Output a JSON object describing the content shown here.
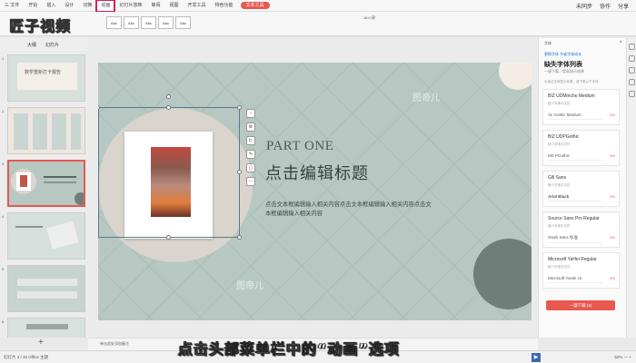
{
  "logo": {
    "text": "匠子视频"
  },
  "ribbon": {
    "tabs": [
      "三 文件",
      "开始",
      "插入",
      "设计",
      "切换",
      "动画",
      "幻灯片放映",
      "审阅",
      "视图",
      "开发工具",
      "特色功能"
    ],
    "highlighted_tab": "动画",
    "pill": "文本工具",
    "right": [
      "未同步",
      "协作",
      "分享"
    ]
  },
  "toolbar": {
    "style_boxes": [
      "Abc",
      "Abc",
      "Abc",
      "Abc",
      "Abc"
    ],
    "font_size_label": "16.0 磅"
  },
  "left_panel": {
    "tabs": [
      "大纲",
      "幻灯片"
    ],
    "slide_numbers": [
      "1",
      "2",
      "3",
      "4",
      "5",
      "6"
    ],
    "thumb1_title": "数学重新打卡报告",
    "add_label": "+"
  },
  "slide": {
    "part_one": "PART ONE",
    "title": "点击编辑标题",
    "body": "点击文本框编辑输入相关内容点击文本框编辑输入相关内容点击文本框编辑输入相关内容",
    "watermark": "图帝儿"
  },
  "right_panel": {
    "header": "字体",
    "link": "更换字体 节省字体成本",
    "title": "缺失字体列表",
    "subtitle": "一键下载，提高演示效果",
    "note": "为保证字体显示效果，请下载以下字体",
    "fonts": [
      {
        "name": "BIZ UDMincho Medium",
        "sub": "缺少字体中文件",
        "sample": "Yu Gothic Medium",
        "price": "5%"
      },
      {
        "name": "BIZ UDPGothic",
        "sub": "缺少字体中文件",
        "sample": "MS PGothic",
        "price": "5%"
      },
      {
        "name": "Gill Sans",
        "sub": "缺少字体中文件",
        "sample": "Arial Black",
        "price": "5%"
      },
      {
        "name": "Source Sans Pro Regular",
        "sub": "缺少字体中文件",
        "sample": "Gwsk Sans 标准",
        "price": "5%"
      },
      {
        "name": "Microsoft YaHei Regular",
        "sub": "缺少字体中文件",
        "sample": "Microsoft YaHei UI",
        "price": "5%"
      }
    ],
    "buy_button": "一键下载 (5)"
  },
  "notes": {
    "placeholder": "单击此处添加备注"
  },
  "status": {
    "left": "幻灯片 3 / 20    Office 主题",
    "right": "52% —  +"
  },
  "caption": "点击头部菜单栏中的“动画”选项"
}
